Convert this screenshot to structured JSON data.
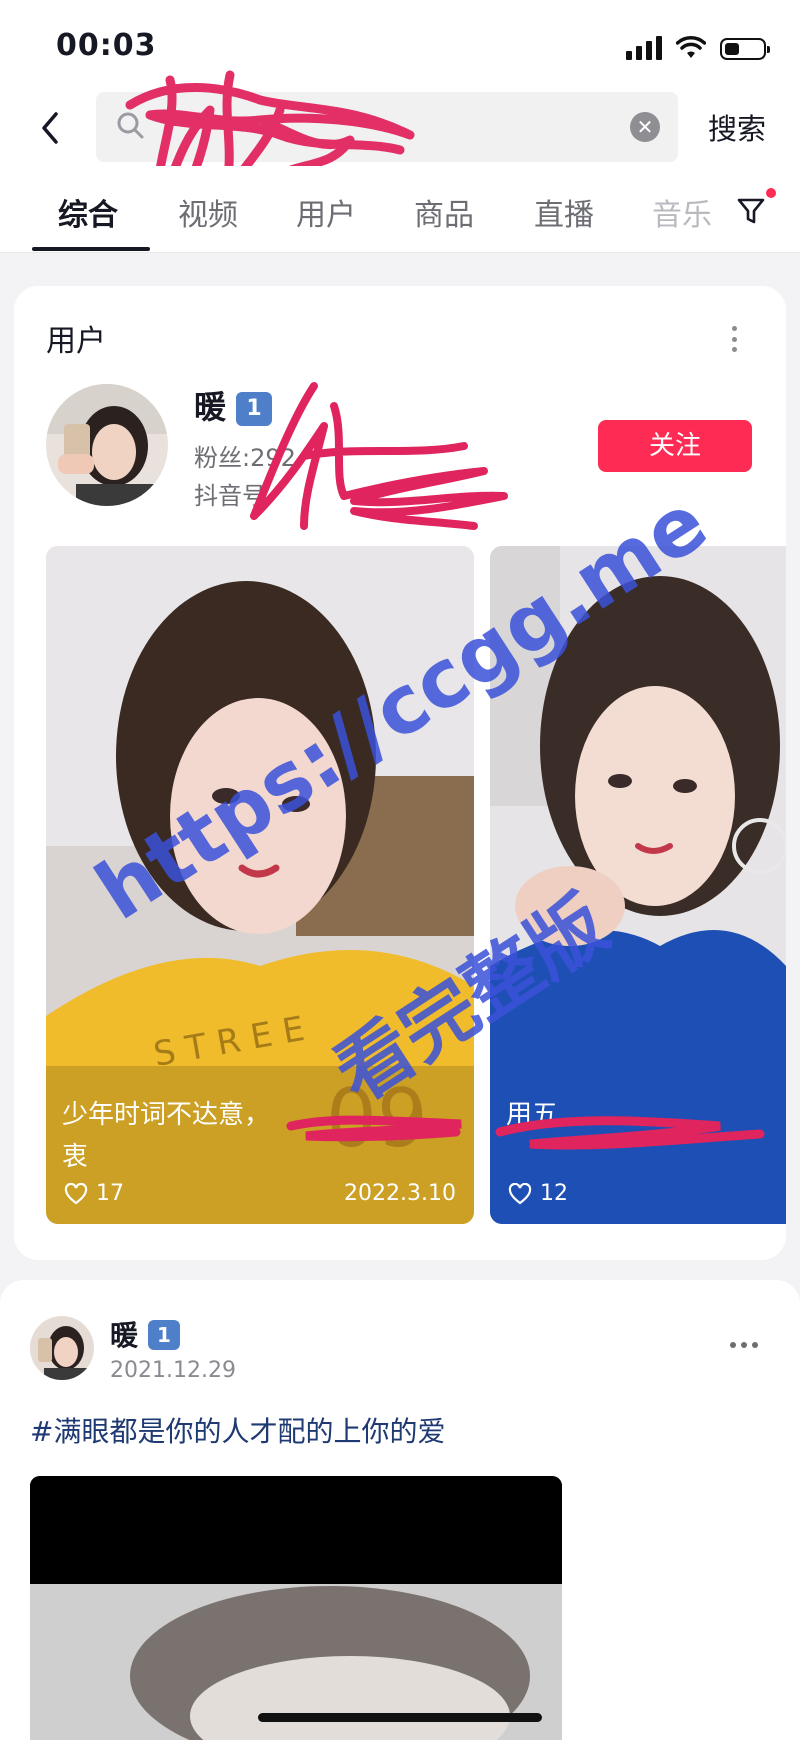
{
  "status_bar": {
    "time": "00:03"
  },
  "search": {
    "value": "",
    "action_label": "搜索"
  },
  "tabs": [
    {
      "label": "综合",
      "active": true
    },
    {
      "label": "视频"
    },
    {
      "label": "用户"
    },
    {
      "label": "商品"
    },
    {
      "label": "直播"
    },
    {
      "label": "音乐"
    }
  ],
  "user_section": {
    "title": "用户",
    "user": {
      "name": "暖",
      "level": "1",
      "fans": "粉丝:292",
      "douyin_id": "抖音号"
    },
    "follow_label": "关注",
    "videos": [
      {
        "title": "少年时词不达意，",
        "title_tail": "衷",
        "likes": "17",
        "date": "2022.3.10"
      },
      {
        "title": "用五",
        "likes": "12"
      }
    ]
  },
  "watermark": {
    "line1": "https://ccgg.me",
    "line2": "看完整版"
  },
  "post": {
    "name": "暖",
    "level": "1",
    "date": "2021.12.29",
    "text": "#满眼都是你的人才配的上你的爱"
  },
  "colors": {
    "accent": "#fe2c55",
    "level_badge": "#4f7fc9",
    "hashtag": "#1f3a73",
    "watermark": "#3b52d9",
    "scribble": "#e0245e"
  }
}
